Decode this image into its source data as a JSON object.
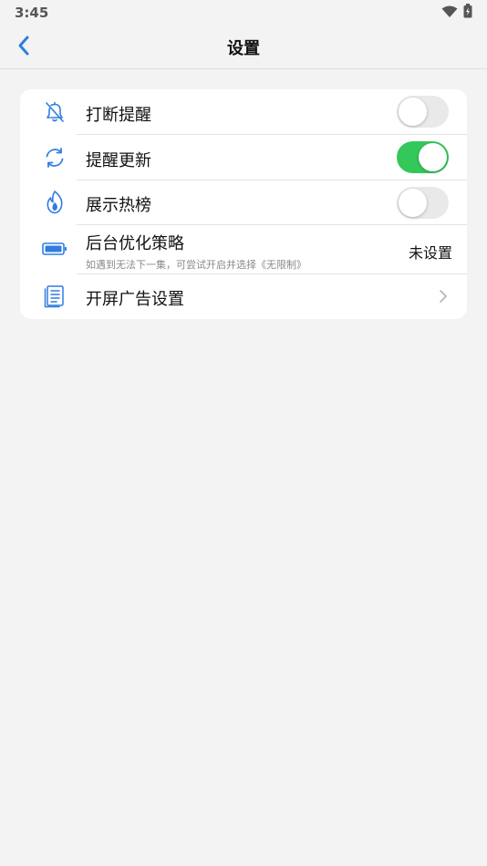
{
  "status_bar": {
    "time": "3:45",
    "icons": [
      "wifi-icon",
      "battery-charging-icon"
    ]
  },
  "nav": {
    "title": "设置",
    "back_icon": "chevron-left-icon"
  },
  "colors": {
    "accent": "#2f7de1",
    "toggle_on": "#34c759",
    "toggle_off": "#e9e9ea",
    "background": "#f3f3f3"
  },
  "settings": {
    "interrupt_reminder": {
      "label": "打断提醒",
      "icon": "bell-off-icon",
      "enabled": false
    },
    "update_reminder": {
      "label": "提醒更新",
      "icon": "refresh-icon",
      "enabled": true
    },
    "hot_list": {
      "label": "展示热榜",
      "icon": "flame-icon",
      "enabled": false
    },
    "background_optimization": {
      "label": "后台优化策略",
      "subtext": "如遇到无法下一集，可尝试开启并选择《无限制》",
      "value": "未设置",
      "icon": "battery-icon"
    },
    "splash_ad": {
      "label": "开屏广告设置",
      "icon": "document-icon",
      "chevron_icon": "chevron-right-icon"
    }
  }
}
